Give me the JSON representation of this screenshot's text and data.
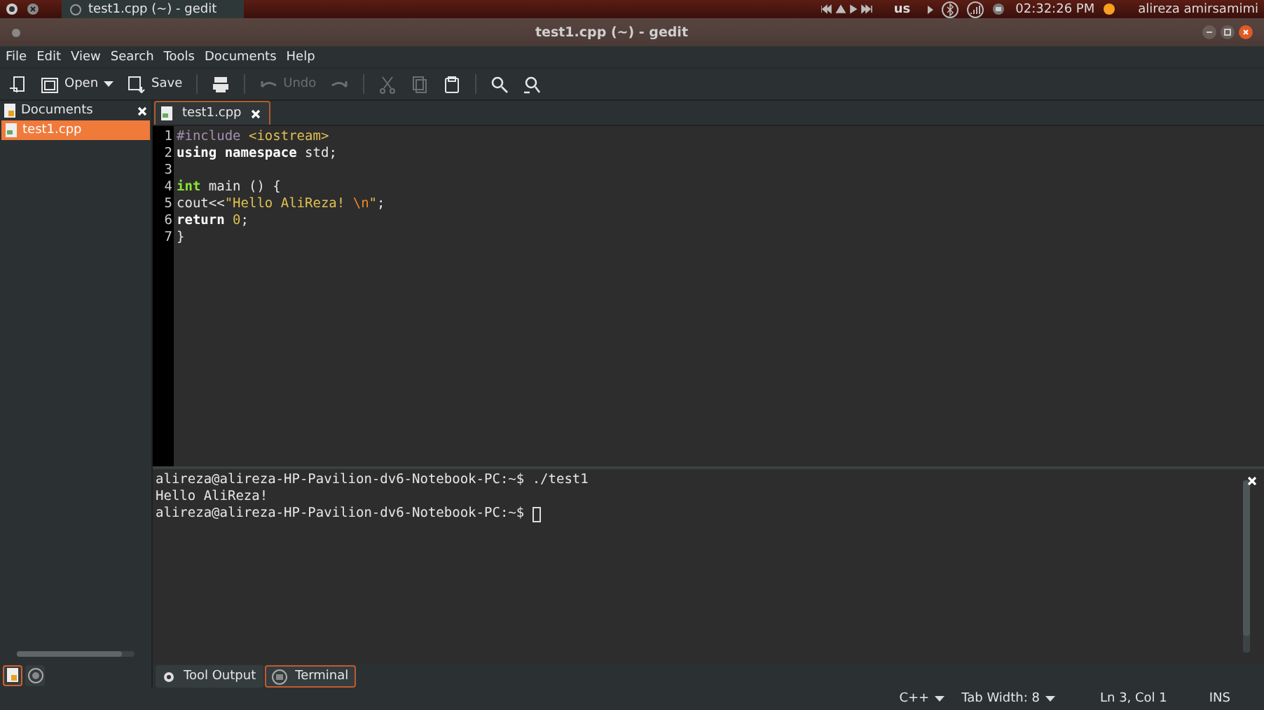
{
  "top_panel": {
    "window_button": "test1.cpp (~) - gedit",
    "keyboard": "us",
    "clock": "02:32:26 PM",
    "user": "alireza amirsamimi"
  },
  "window": {
    "title": "test1.cpp (~) - gedit"
  },
  "menu": [
    "File",
    "Edit",
    "View",
    "Search",
    "Tools",
    "Documents",
    "Help"
  ],
  "toolbar": [
    {
      "kind": "icon",
      "disabled": false
    },
    {
      "kind": "text",
      "label": "Open",
      "disabled": false,
      "dropdown": true
    },
    {
      "kind": "text",
      "label": "Save",
      "disabled": false,
      "dropdown": false
    },
    {
      "kind": "separator"
    },
    {
      "kind": "icon",
      "disabled": false
    },
    {
      "kind": "separator"
    },
    {
      "kind": "text",
      "label": "Undo",
      "disabled": true,
      "dropdown": false
    },
    {
      "kind": "icon",
      "disabled": true
    },
    {
      "kind": "separator"
    },
    {
      "kind": "icon",
      "disabled": true
    },
    {
      "kind": "icon",
      "disabled": true
    },
    {
      "kind": "icon",
      "disabled": false
    },
    {
      "kind": "separator"
    },
    {
      "kind": "icon",
      "disabled": false
    },
    {
      "kind": "icon",
      "disabled": false
    }
  ],
  "sidebar": {
    "title": "Documents",
    "items": [
      {
        "label": "test1.cpp",
        "selected": true
      }
    ],
    "tabs": [
      {
        "selected": true
      },
      {
        "selected": false
      }
    ]
  },
  "editor": {
    "tabs": [
      {
        "label": "test1.cpp",
        "selected": true
      }
    ],
    "lines": [
      {
        "number": "1",
        "tokens": [
          {
            "text": "#include ",
            "kind": "preproc"
          },
          {
            "text": "<iostream>",
            "kind": "include"
          }
        ]
      },
      {
        "number": "2",
        "tokens": [
          {
            "text": "using ",
            "kind": "keyword"
          },
          {
            "text": "namespace",
            "kind": "keyword"
          },
          {
            "text": " std;",
            "kind": "plain"
          }
        ]
      },
      {
        "number": "3"
      },
      {
        "number": "4",
        "tokens": [
          {
            "text": "int",
            "kind": "type"
          },
          {
            "text": " main () {",
            "kind": "plain"
          }
        ]
      },
      {
        "number": "5",
        "tokens": [
          {
            "text": "cout<<",
            "kind": "plain"
          },
          {
            "text": "\"Hello AliReza! ",
            "kind": "string"
          },
          {
            "text": "\\n",
            "kind": "escape"
          },
          {
            "text": "\"",
            "kind": "string"
          },
          {
            "text": ";",
            "kind": "plain"
          }
        ]
      },
      {
        "number": "6",
        "tokens": [
          {
            "text": "return ",
            "kind": "keyword"
          },
          {
            "text": "0",
            "kind": "number"
          },
          {
            "text": ";",
            "kind": "plain"
          }
        ]
      },
      {
        "number": "7",
        "tokens": [
          {
            "text": "}",
            "kind": "plain"
          }
        ]
      }
    ]
  },
  "terminal": {
    "lines": [
      "alireza@alireza-HP-Pavilion-dv6-Notebook-PC:~$ ./test1",
      "Hello AliReza!",
      "alireza@alireza-HP-Pavilion-dv6-Notebook-PC:~$ "
    ],
    "cursor": true
  },
  "bottom_tabs": [
    {
      "label": "Tool Output",
      "selected": false
    },
    {
      "label": "Terminal",
      "selected": true
    }
  ],
  "status_bar": {
    "language": "C++",
    "tab_width": "Tab Width: 8",
    "position": "Ln 3, Col 1",
    "mode": "INS"
  }
}
